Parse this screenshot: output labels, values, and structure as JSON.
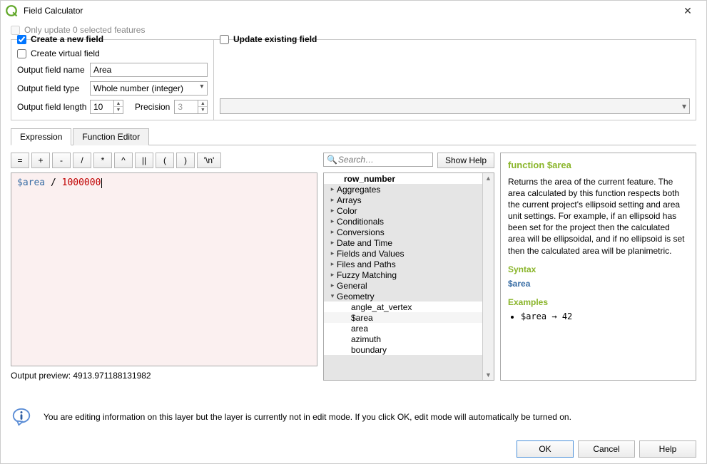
{
  "window": {
    "title": "Field Calculator"
  },
  "top": {
    "onlyUpdate": "Only update 0 selected features",
    "createNew": "Create a new field",
    "updateExisting": "Update existing field",
    "createVirtual": "Create virtual field",
    "outName": "Output field name",
    "outNameVal": "Area",
    "outType": "Output field type",
    "outTypeVal": "Whole number (integer)",
    "outLen": "Output field length",
    "outLenVal": "10",
    "precision": "Precision",
    "precisionVal": "3"
  },
  "tabs": {
    "expression": "Expression",
    "functionEditor": "Function Editor"
  },
  "ops": [
    "=",
    "+",
    "-",
    "/",
    "*",
    "^",
    "||",
    "(",
    ")",
    "'\\n'"
  ],
  "expr": {
    "var": "$area",
    "op": " / ",
    "num": "1000000"
  },
  "preview": {
    "label": "Output preview:  ",
    "value": "4913.971188131982"
  },
  "search": {
    "placeholder": "Search…",
    "showHelp": "Show Help"
  },
  "tree": {
    "header": "row_number",
    "groups": [
      "Aggregates",
      "Arrays",
      "Color",
      "Conditionals",
      "Conversions",
      "Date and Time",
      "Fields and Values",
      "Files and Paths",
      "Fuzzy Matching",
      "General",
      "Geometry"
    ],
    "geometryChildren": [
      "angle_at_vertex",
      "$area",
      "area",
      "azimuth",
      "boundary"
    ],
    "selected": "$area"
  },
  "help": {
    "title": "function $area",
    "body": "Returns the area of the current feature. The area calculated by this function respects both the current project's ellipsoid setting and area unit settings. For example, if an ellipsoid has been set for the project then the calculated area will be ellipsoidal, and if no ellipsoid is set then the calculated area will be planimetric.",
    "syntax": "Syntax",
    "syntaxVal": "$area",
    "examples": "Examples",
    "exExpr": "$area",
    "exArrow": " → ",
    "exVal": "42"
  },
  "info": "You are editing information on this layer but the layer is currently not in edit mode. If you click OK, edit mode will automatically be turned on.",
  "buttons": {
    "ok": "OK",
    "cancel": "Cancel",
    "help": "Help"
  }
}
